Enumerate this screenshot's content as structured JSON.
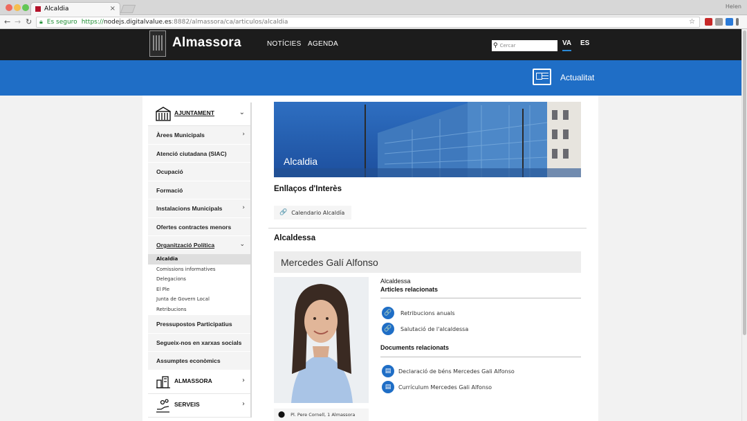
{
  "browser": {
    "tab_title": "Alcaldia",
    "tab_close": "×",
    "user_name": "Helen",
    "secure_label": "Es seguro",
    "url_scheme": "https://",
    "url_host": "nodejs.digitalvalue.es",
    "url_path": ":8882/almassora/ca/articulos/alcaldia",
    "back_glyph": "←",
    "forward_glyph": "→",
    "reload_glyph": "↻",
    "star_glyph": "☆"
  },
  "header": {
    "brand": "Almassora",
    "nav": [
      "NOTÍCIES",
      "AGENDA"
    ],
    "search_placeholder": "Cercar",
    "search_glyph": "⚲",
    "languages": [
      "VA",
      "ES"
    ],
    "active_language": "VA",
    "band_label": "Actualitat"
  },
  "sidebar": {
    "ajuntament": "AJUNTAMENT",
    "chevron_down": "⌄",
    "chevron_right": "›",
    "items": [
      {
        "label": "Àrees Municipals",
        "has_children": true
      },
      {
        "label": "Atenció ciutadana (SIAC)",
        "has_children": false
      },
      {
        "label": "Ocupació",
        "has_children": false
      },
      {
        "label": "Formació",
        "has_children": false
      },
      {
        "label": "Instalacions Municipals",
        "has_children": true
      },
      {
        "label": "Ofertes contractes menors",
        "has_children": false
      },
      {
        "label": "Organització Política",
        "has_children": false,
        "expanded": true
      }
    ],
    "subitems": [
      "Alcaldia",
      "Comissions informatives",
      "Delegacions",
      "El Ple",
      "Junta de Govern Local",
      "Retribucions"
    ],
    "active_subitem": "Alcaldia",
    "items_after": [
      "Pressupostos Participatius",
      "Segueix-nos en xarxas socials",
      "Assumptes econòmics"
    ],
    "almassora": "ALMASSORA",
    "serveis": "SERVEIS"
  },
  "main": {
    "hero_title": "Alcaldia",
    "links_heading": "Enllaços d'Interès",
    "link_glyph": "🔗",
    "link_chip": "Calendario Alcaldía",
    "section_title": "Alcaldessa",
    "person_name": "Mercedes Galí Alfonso",
    "role": "Alcaldessa",
    "articles_heading": "Articles relacionats",
    "articles": [
      "Retribucions anuals",
      "Salutació de l'alcaldessa"
    ],
    "documents_heading": "Documents relacionats",
    "documents": [
      "Declaració de béns Mercedes Gali Alfonso",
      "Currículum Mercedes Gali Alfonso"
    ],
    "address": "Pl. Pere Cornell, 1 Almassora",
    "pin_glyph": "⬤",
    "doc_glyph": "▤"
  },
  "colors": {
    "brand_blue": "#1f6ec6",
    "header_black": "#1c1c1c"
  }
}
